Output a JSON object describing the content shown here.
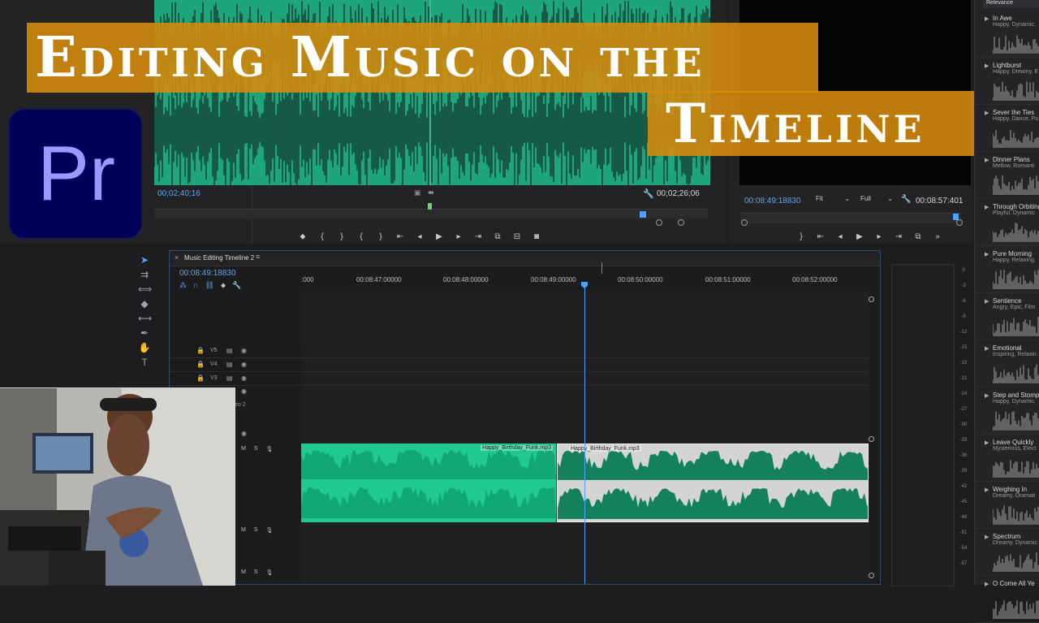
{
  "title_banner": {
    "line1": "Editing Music on the",
    "line2": "Timeline"
  },
  "app_logo_text": "Pr",
  "source_monitor": {
    "timecode_in": "00;02;40;16",
    "timecode_duration": "00;02;26;06"
  },
  "program_monitor": {
    "timecode": "00:08:49:18830",
    "fit_label": "Fit",
    "full_label": "Full",
    "duration": "00:08:57:401"
  },
  "timeline": {
    "tab_title": "Music Editing Timeline 2",
    "close_glyph": "×",
    "menu_glyph": "≡",
    "playhead_timecode": "00:08:49:18830",
    "ruler_labels": [
      ":000",
      "00:08:47:00000",
      "00:08:48:00000",
      "00:08:49:00000",
      "00:08:50:00000",
      "00:08:51:00000",
      "00:08:52:00000"
    ],
    "tracks": [
      {
        "name": "V5"
      },
      {
        "name": "V4"
      },
      {
        "name": "V3"
      }
    ],
    "track_label_partial": "eo 2",
    "track_letters": {
      "mute": "M",
      "solo": "S"
    },
    "clips": [
      {
        "label": "Happy_Birthday_Funk.mp3"
      },
      {
        "label": "Happy_Birthday_Funk.mp3"
      }
    ]
  },
  "music_browser": {
    "sort_label": "Relevance",
    "items": [
      {
        "name": "In Awe",
        "tags": "Happy, Dynamic,"
      },
      {
        "name": "Lightburst",
        "tags": "Happy, Dreamy, E"
      },
      {
        "name": "Sever the Ties",
        "tags": "Happy, Dance, Po"
      },
      {
        "name": "Dinner Plans",
        "tags": "Mellow, Romanti"
      },
      {
        "name": "Through Orbiting",
        "tags": "Playful, Dynamic"
      },
      {
        "name": "Pure Morning",
        "tags": "Happy, Relaxing,"
      },
      {
        "name": "Sentience",
        "tags": "Angry, Epic, Film"
      },
      {
        "name": "Emotional",
        "tags": "Inspiring, Relaxin"
      },
      {
        "name": "Step and Stomp",
        "tags": "Happy, Dynamic,"
      },
      {
        "name": "Leave Quickly",
        "tags": "Mysterious, Elect"
      },
      {
        "name": "Weighing In",
        "tags": "Dreamy, Dramati"
      },
      {
        "name": "Spectrum",
        "tags": "Dreamy, Dynamic"
      },
      {
        "name": "O Come All Ye",
        "tags": ""
      }
    ]
  },
  "db_scale": [
    "0",
    "-3",
    "-6",
    "-9",
    "-12",
    "-15",
    "-18",
    "-21",
    "-24",
    "-27",
    "-30",
    "-33",
    "-36",
    "-39",
    "-42",
    "-45",
    "-48",
    "-51",
    "-54",
    "-57"
  ],
  "colors": {
    "accent": "#5ea4e8",
    "clip_green": "#1fc990",
    "banner": "#d68c0c",
    "logo_bg": "#00005b",
    "logo_text": "#9999ff"
  }
}
